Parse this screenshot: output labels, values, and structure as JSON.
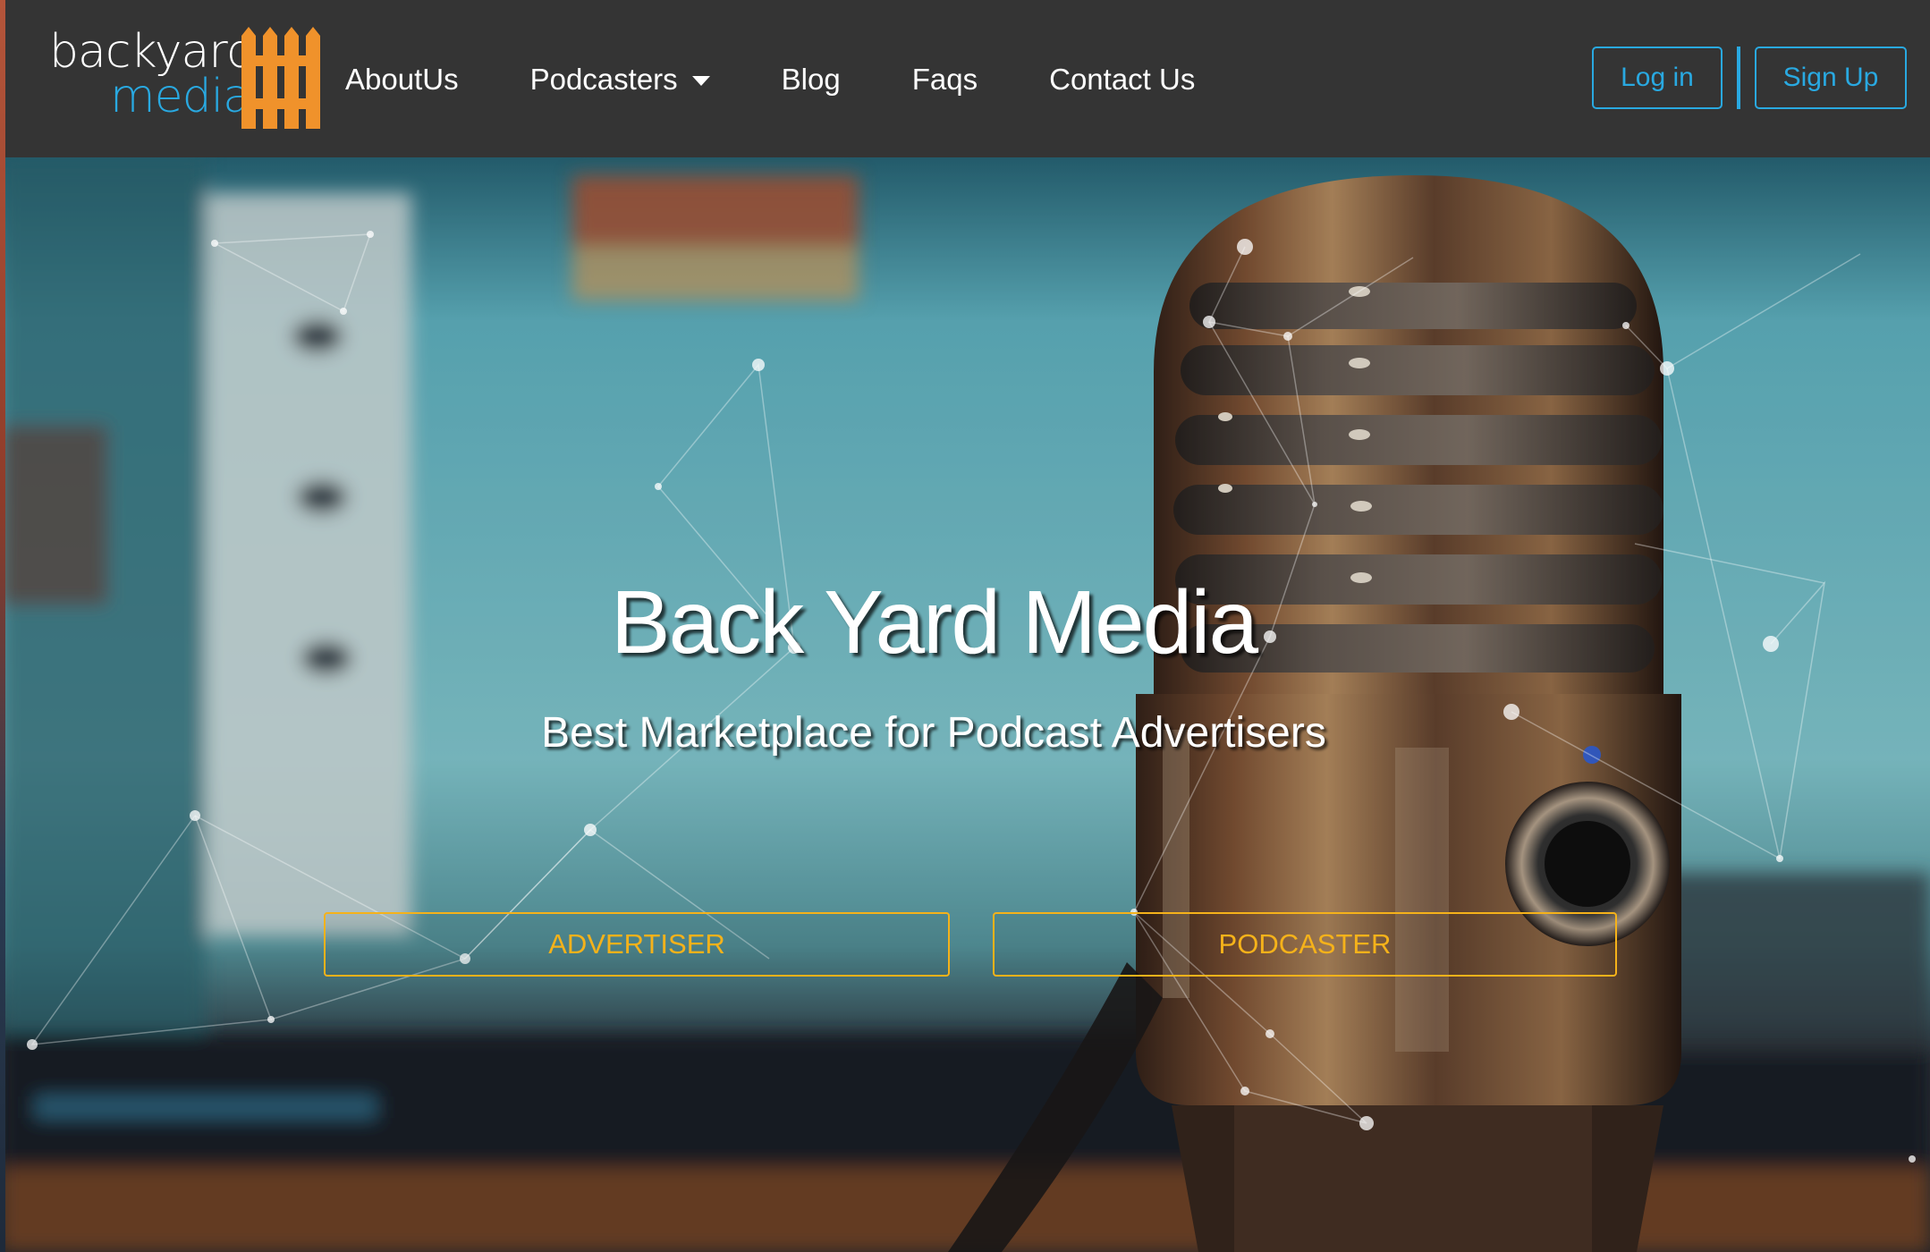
{
  "brand": {
    "logo_top": "backyard",
    "logo_bottom": "media",
    "logo_icon": "fence-icon",
    "colors": {
      "logo_blue": "#29a9e1",
      "fence_orange": "#f0922b"
    }
  },
  "nav": {
    "items": [
      {
        "label": "AboutUs"
      },
      {
        "label": "Podcasters",
        "icon": "caret-down-icon"
      },
      {
        "label": "Blog"
      },
      {
        "label": "Faqs"
      },
      {
        "label": "Contact Us"
      }
    ]
  },
  "auth": {
    "login_label": "Log in",
    "signup_label": "Sign Up",
    "accent": "#29a9e1"
  },
  "hero": {
    "title": "Back Yard Media",
    "subtitle": "Best Marketplace for Podcast Advertisers",
    "background": "microphone-photo",
    "cta_color": "#f5b21a",
    "buttons": {
      "advertiser_label": "ADVERTISER",
      "podcaster_label": "PODCASTER"
    }
  }
}
